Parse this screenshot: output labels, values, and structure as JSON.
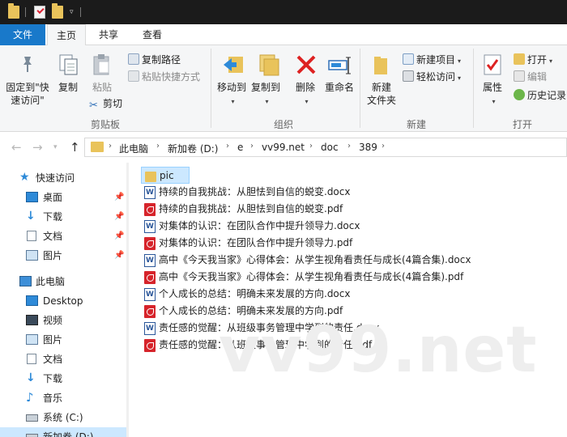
{
  "ribbon_tabs": {
    "file": "文件",
    "home": "主页",
    "share": "共享",
    "view": "查看"
  },
  "clipboard": {
    "pin_quick_access": "固定到\"快\n速访问\"",
    "copy": "复制",
    "paste": "粘贴",
    "copy_path": "复制路径",
    "paste_shortcut": "粘贴快捷方式",
    "cut": "剪切",
    "group_label": "剪贴板"
  },
  "organize": {
    "move_to": "移动到",
    "copy_to": "复制到",
    "delete": "删除",
    "rename": "重命名",
    "group_label": "组织"
  },
  "new_group": {
    "new_folder": "新建\n文件夹",
    "new_item": "新建项目",
    "easy_access": "轻松访问",
    "group_label": "新建"
  },
  "open_group": {
    "properties": "属性",
    "open": "打开",
    "edit": "编辑",
    "history": "历史记录",
    "group_label": "打开"
  },
  "address": {
    "crumbs": [
      "此电脑",
      "新加卷 (D:)",
      "e",
      "vv99.net",
      "doc",
      "389"
    ]
  },
  "nav_pane": {
    "quick_access": "快速访问",
    "quick_items": [
      "桌面",
      "下载",
      "文档",
      "图片"
    ],
    "this_pc": "此电脑",
    "pc_items": [
      "Desktop",
      "视频",
      "图片",
      "文档",
      "下载",
      "音乐",
      "系统 (C:)",
      "新加卷 (D:)"
    ]
  },
  "files": [
    {
      "name": "pic",
      "type": "folder"
    },
    {
      "name": "持续的自我挑战：从胆怯到自信的蜕变.docx",
      "type": "docx"
    },
    {
      "name": "持续的自我挑战：从胆怯到自信的蜕变.pdf",
      "type": "pdf"
    },
    {
      "name": "对集体的认识：在团队合作中提升领导力.docx",
      "type": "docx"
    },
    {
      "name": "对集体的认识：在团队合作中提升领导力.pdf",
      "type": "pdf"
    },
    {
      "name": "高中《今天我当家》心得体会：从学生视角看责任与成长(4篇合集).docx",
      "type": "docx"
    },
    {
      "name": "高中《今天我当家》心得体会：从学生视角看责任与成长(4篇合集).pdf",
      "type": "pdf"
    },
    {
      "name": "个人成长的总结：明确未来发展的方向.docx",
      "type": "docx"
    },
    {
      "name": "个人成长的总结：明确未来发展的方向.pdf",
      "type": "pdf"
    },
    {
      "name": "责任感的觉醒：从班级事务管理中学到的责任.docx",
      "type": "docx"
    },
    {
      "name": "责任感的觉醒：从班级事务管理中学到的责任.pdf",
      "type": "pdf"
    }
  ],
  "watermark": "vv99.net",
  "colors": {
    "accent": "#1979ca",
    "folder": "#e9c35b",
    "selection": "#cce8ff",
    "pdf": "#d6242b",
    "word": "#2b579a"
  }
}
